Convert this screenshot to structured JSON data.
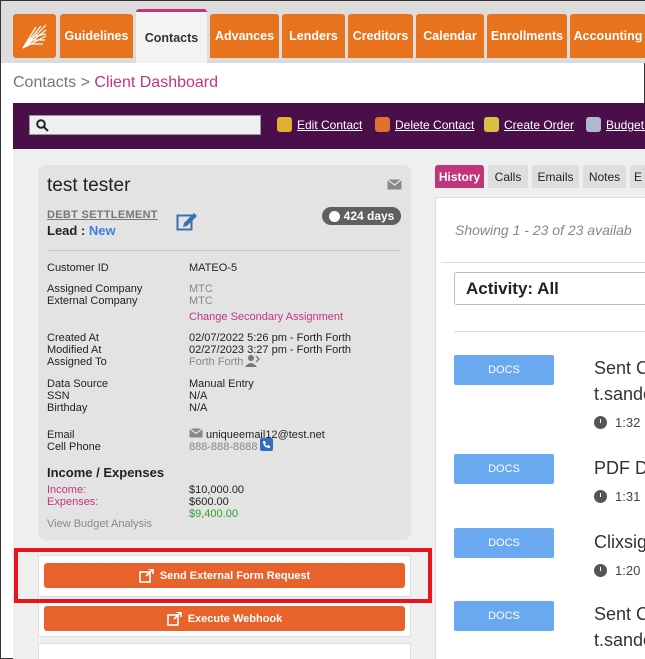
{
  "nav": {
    "tabs": [
      "Guidelines",
      "Contacts",
      "Advances",
      "Lenders",
      "Creditors",
      "Calendar",
      "Enrollments",
      "Accounting"
    ],
    "active": "Contacts"
  },
  "breadcrumb": {
    "parent": "Contacts",
    "separator": ">",
    "current": "Client Dashboard"
  },
  "toolbar": {
    "search_placeholder": "",
    "actions": [
      "Edit Contact",
      "Delete Contact",
      "Create Order",
      "Budget A"
    ]
  },
  "contact": {
    "name": "test tester",
    "program": "DEBT SETTLEMENT",
    "lead_label": "Lead :",
    "lead_status": "New",
    "days_badge": "424 days",
    "customer_id_label": "Customer ID",
    "customer_id": "MATEO-5",
    "assigned_company_label": "Assigned Company",
    "assigned_company": "MTC",
    "external_company_label": "External Company",
    "external_company": "MTC",
    "change_secondary": "Change Secondary Assignment",
    "created_label": "Created At",
    "created": "02/07/2022 5:26 pm - Forth Forth",
    "modified_label": "Modified At",
    "modified": "02/27/2023 3:27 pm - Forth Forth",
    "assigned_to_label": "Assigned To",
    "assigned_to": "Forth Forth",
    "data_source_label": "Data Source",
    "data_source": "Manual Entry",
    "ssn_label": "SSN",
    "ssn": "N/A",
    "birthday_label": "Birthday",
    "birthday": "N/A",
    "email_label": "Email",
    "email": "uniqueemail12@test.net",
    "phone_label": "Cell Phone",
    "phone": "888-888-8888",
    "income_heading": "Income / Expenses",
    "income_label": "Income:",
    "income": "$10,000.00",
    "expenses_label": "Expenses:",
    "expenses": "$600.00",
    "net": "$9,400.00",
    "budget_link": "View Budget Analysis"
  },
  "buttons": {
    "send_form": "Send External Form Request",
    "webhook": "Execute Webhook"
  },
  "right": {
    "tabs": [
      "History",
      "Calls",
      "Emails",
      "Notes",
      "E"
    ],
    "showing": "Showing 1 - 23 of 23 availab",
    "activity_filter": "Activity: All",
    "items": [
      {
        "badge": "DOCS",
        "text": "Sent C",
        "sub": "t.sande",
        "time": "1:32"
      },
      {
        "badge": "DOCS",
        "text": "PDF D",
        "sub": "",
        "time": "1:31"
      },
      {
        "badge": "DOCS",
        "text": "Clixsig",
        "sub": "",
        "time": "1:20"
      },
      {
        "badge": "DOCS",
        "text": "Sent C",
        "sub": "t.sande",
        "time": ""
      }
    ]
  },
  "colors": {
    "accent_orange": "#e8731c",
    "brand_purple": "#4a0f4b",
    "pink": "#c2357b",
    "highlight_red": "#e8141e",
    "docs_blue": "#6aa9ef"
  }
}
